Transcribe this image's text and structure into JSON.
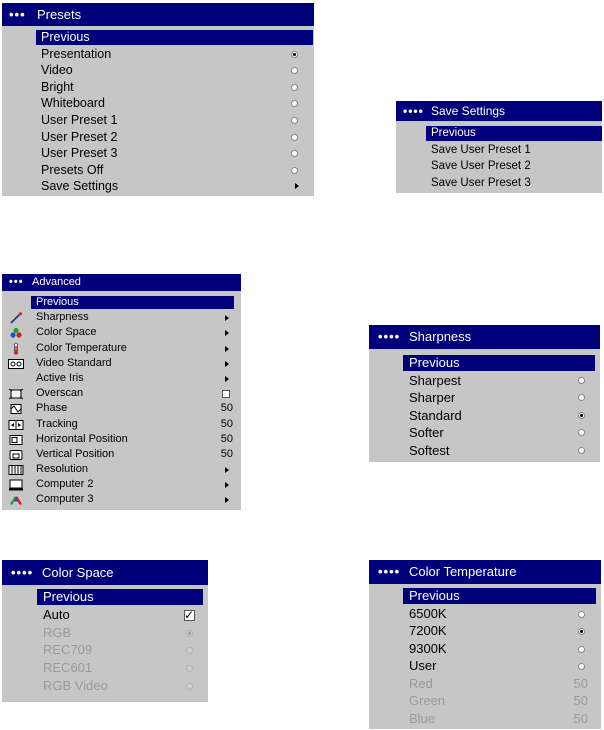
{
  "presets": {
    "dots": "•••",
    "title": "Presets",
    "items": [
      {
        "label": "Previous",
        "kind": "selected"
      },
      {
        "label": "Presentation",
        "kind": "radio",
        "checked": true
      },
      {
        "label": "Video",
        "kind": "radio",
        "checked": false
      },
      {
        "label": "Bright",
        "kind": "radio",
        "checked": false
      },
      {
        "label": "Whiteboard",
        "kind": "radio",
        "checked": false
      },
      {
        "label": "User Preset 1",
        "kind": "radio",
        "checked": false
      },
      {
        "label": "User Preset 2",
        "kind": "radio",
        "checked": false
      },
      {
        "label": "User Preset 3",
        "kind": "radio",
        "checked": false
      },
      {
        "label": "Presets Off",
        "kind": "radio",
        "checked": false
      },
      {
        "label": "Save Settings",
        "kind": "submenu"
      }
    ]
  },
  "save_settings": {
    "dots": "••••",
    "title": "Save Settings",
    "items": [
      {
        "label": "Previous",
        "kind": "selected"
      },
      {
        "label": "Save User Preset 1",
        "kind": "text"
      },
      {
        "label": "Save User Preset 2",
        "kind": "text"
      },
      {
        "label": "Save User Preset 3",
        "kind": "text"
      }
    ]
  },
  "advanced": {
    "dots": "•••",
    "title": "Advanced",
    "items": [
      {
        "label": "Previous",
        "kind": "selected"
      },
      {
        "label": "Sharpness",
        "kind": "submenu",
        "icon": "sharpness-icon"
      },
      {
        "label": "Color Space",
        "kind": "submenu",
        "icon": "color-space-icon"
      },
      {
        "label": "Color Temperature",
        "kind": "submenu",
        "icon": "color-temperature-icon"
      },
      {
        "label": "Video Standard",
        "kind": "submenu",
        "icon": "video-standard-icon"
      },
      {
        "label": "Active Iris",
        "kind": "submenu",
        "icon": ""
      },
      {
        "label": "Overscan",
        "kind": "check",
        "checked": false,
        "icon": "overscan-icon"
      },
      {
        "label": "Phase",
        "kind": "value",
        "value": "50",
        "icon": "phase-icon"
      },
      {
        "label": "Tracking",
        "kind": "value",
        "value": "50",
        "icon": "tracking-icon"
      },
      {
        "label": "Horizontal Position",
        "kind": "value",
        "value": "50",
        "icon": "horizontal-position-icon"
      },
      {
        "label": "Vertical Position",
        "kind": "value",
        "value": "50",
        "icon": "vertical-position-icon"
      },
      {
        "label": "Resolution",
        "kind": "submenu",
        "icon": "resolution-icon"
      },
      {
        "label": "Computer 2",
        "kind": "submenu",
        "icon": "computer-icon"
      },
      {
        "label": "Computer 3",
        "kind": "submenu",
        "icon": "computer-3-icon"
      }
    ]
  },
  "sharpness": {
    "dots": "••••",
    "title": "Sharpness",
    "items": [
      {
        "label": "Previous",
        "kind": "selected"
      },
      {
        "label": "Sharpest",
        "kind": "radio",
        "checked": false
      },
      {
        "label": "Sharper",
        "kind": "radio",
        "checked": false
      },
      {
        "label": "Standard",
        "kind": "radio",
        "checked": true
      },
      {
        "label": "Softer",
        "kind": "radio",
        "checked": false
      },
      {
        "label": "Softest",
        "kind": "radio",
        "checked": false
      }
    ]
  },
  "color_space": {
    "dots": "••••",
    "title": "Color Space",
    "items": [
      {
        "label": "Previous",
        "kind": "selected"
      },
      {
        "label": "Auto",
        "kind": "check",
        "checked": true
      },
      {
        "label": "RGB",
        "kind": "radio",
        "checked": true,
        "disabled": true
      },
      {
        "label": "REC709",
        "kind": "radio",
        "checked": false,
        "disabled": true
      },
      {
        "label": "REC601",
        "kind": "radio",
        "checked": false,
        "disabled": true
      },
      {
        "label": "RGB Video",
        "kind": "radio",
        "checked": false,
        "disabled": true
      }
    ]
  },
  "color_temperature": {
    "dots": "••••",
    "title": "Color Temperature",
    "items": [
      {
        "label": "Previous",
        "kind": "selected"
      },
      {
        "label": "6500K",
        "kind": "radio",
        "checked": false
      },
      {
        "label": "7200K",
        "kind": "radio",
        "checked": true
      },
      {
        "label": "9300K",
        "kind": "radio",
        "checked": false
      },
      {
        "label": "User",
        "kind": "radio",
        "checked": false
      },
      {
        "label": "Red",
        "kind": "value",
        "value": "50",
        "disabled": true
      },
      {
        "label": "Green",
        "kind": "value",
        "value": "50",
        "disabled": true
      },
      {
        "label": "Blue",
        "kind": "value",
        "value": "50",
        "disabled": true
      }
    ]
  },
  "colors": {
    "titlebar": "#00007b",
    "menu_bg": "#c6c6c6",
    "disabled_text": "#9a9a9a"
  }
}
